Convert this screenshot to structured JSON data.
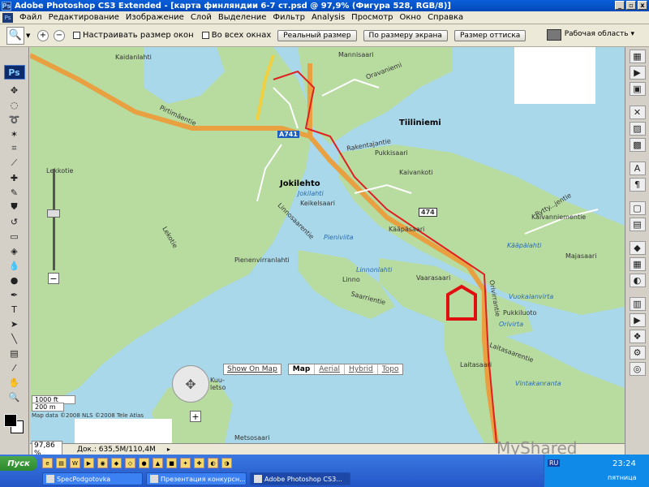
{
  "window": {
    "title": "Adobe Photoshop CS3 Extended - [карта финляндии 6-7 ст.psd @ 97,9% (Фигура 528, RGB/8)]",
    "app_icon": "Ps",
    "controls": [
      "_",
      "▫",
      "x"
    ]
  },
  "menubar": {
    "items": [
      "Файл",
      "Редактирование",
      "Изображение",
      "Слой",
      "Выделение",
      "Фильтр",
      "Analysis",
      "Просмотр",
      "Окно",
      "Справка"
    ]
  },
  "options_bar": {
    "resize_windows_label": "Настраивать размер окон",
    "all_windows_label": "Во всех окнах",
    "actual_pixels_label": "Реальный размер",
    "fit_screen_label": "По размеру экрана",
    "print_size_label": "Размер оттиска",
    "workspace_label": "Рабочая область ▾"
  },
  "toolbox": {
    "logo": "Ps"
  },
  "map": {
    "places": {
      "tiiliniemi": "Tiiliniemi",
      "jokilehto": "Jokilehto",
      "jokilahti": "Jokilahti",
      "keikelsaari": "Keikelsaari",
      "pieniviita": "Pieniviita",
      "pienenvirranlahti": "Pienenvirranlahti",
      "linnonlahti": "Linnonlahti",
      "vaarasaari": "Vaarasaari",
      "kaapasaari": "Kääpäsaari",
      "kaapalahti": "Kääpälahti",
      "majasaari": "Majasaari",
      "vuokalanvirta": "Vuokalanvirta",
      "pukkiluoto": "Pukkiluoto",
      "orivirta": "Orivirta",
      "laitasaari": "Laitasaari",
      "vintakanranta": "Vintakanranta",
      "metsosaari": "Metsosaari",
      "pukkisaari": "Pukkisaari",
      "kaidanlahti": "Kaidanlahti",
      "pirtimaentie": "Pirtimäentie",
      "lekkotie": "Lekkotie",
      "lekotie": "Lekotie",
      "linnosaarentie": "Linnosaarentie",
      "ryttyjentie": "Rytty...jentie",
      "kaivannientie": "Kaivanniementie",
      "kaivankoti": "Kaivankoti",
      "linno": "Linno",
      "saarentie": "Saarrientie",
      "orivirranti": "Orivirrantie",
      "laitasaarentie": "Laitasaarentie",
      "mannisaari": "Mannisaari",
      "oravaniemi": "Oravaniemi",
      "road_474": "474",
      "road_a741": "A741",
      "kuvalehto": "Kuu-\nletso",
      "rakentajantie": "Rakentajantie"
    },
    "controls": {
      "show_on_map": "Show On Map",
      "map": "Map",
      "aerial": "Aerial",
      "hybrid": "Hybrid",
      "topo": "Topo",
      "zoom_plus": "+",
      "zoom_minus": "−"
    },
    "scale_ft": "1000 ft",
    "scale_m": "200 m",
    "copyright": "Map data ©2008 NLS ©2008 Tele Atlas"
  },
  "statusbar": {
    "zoom": "97,86 %",
    "doc": "Док.: 635,5M/110,4M",
    "arrow": "▸"
  },
  "taskbar": {
    "start": "Пуск",
    "tasks": [
      {
        "label": "SpecPodgotovka"
      },
      {
        "label": "Презентация конкурсн..."
      },
      {
        "label": "Adobe Photoshop CS3..."
      }
    ],
    "lang": "RU",
    "time": "23:24",
    "day": "пятница"
  },
  "watermark": "MyShared",
  "colors": {
    "water": "#a8d8ea",
    "land": "#b8dca0",
    "road_major": "#e8a040",
    "route": "#e02020",
    "marker": "#e01010"
  }
}
